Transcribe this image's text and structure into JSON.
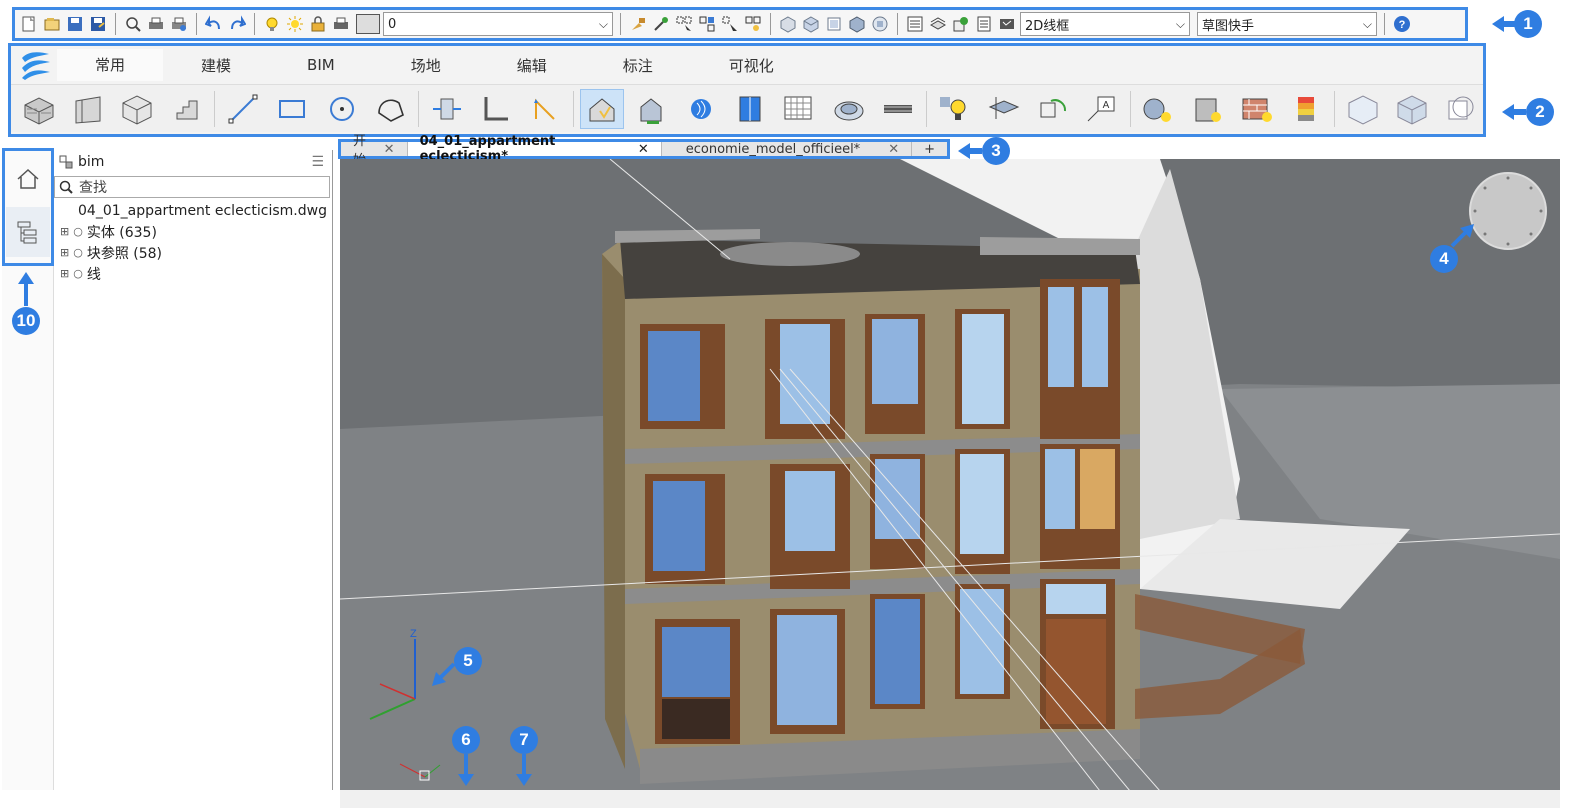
{
  "quick_access": {
    "layer_value": "0",
    "visual_style": "2D线框",
    "workspace": "草图快手"
  },
  "ribbon": {
    "tabs": [
      "常用",
      "建模",
      "BIM",
      "场地",
      "编辑",
      "标注",
      "可视化"
    ],
    "active_tab": "常用"
  },
  "document_tabs": {
    "tabs": [
      {
        "label": "开始"
      },
      {
        "label": "04_01_appartment eclecticism*"
      },
      {
        "label": "economie_model_officieel*"
      }
    ],
    "add_label": "+"
  },
  "browser": {
    "title": "bim",
    "search_placeholder": "查找",
    "file_name": "04_01_appartment eclecticism.dwg",
    "items": [
      {
        "label": "实体 (635)"
      },
      {
        "label": "块参照 (58)"
      },
      {
        "label": "线"
      }
    ]
  },
  "callouts": [
    "1",
    "2",
    "3",
    "4",
    "5",
    "6",
    "7",
    "10"
  ],
  "colors": {
    "callout": "#2f7de1",
    "highlight_border": "#3e8ae6",
    "viewport_bg": "#77797b"
  }
}
